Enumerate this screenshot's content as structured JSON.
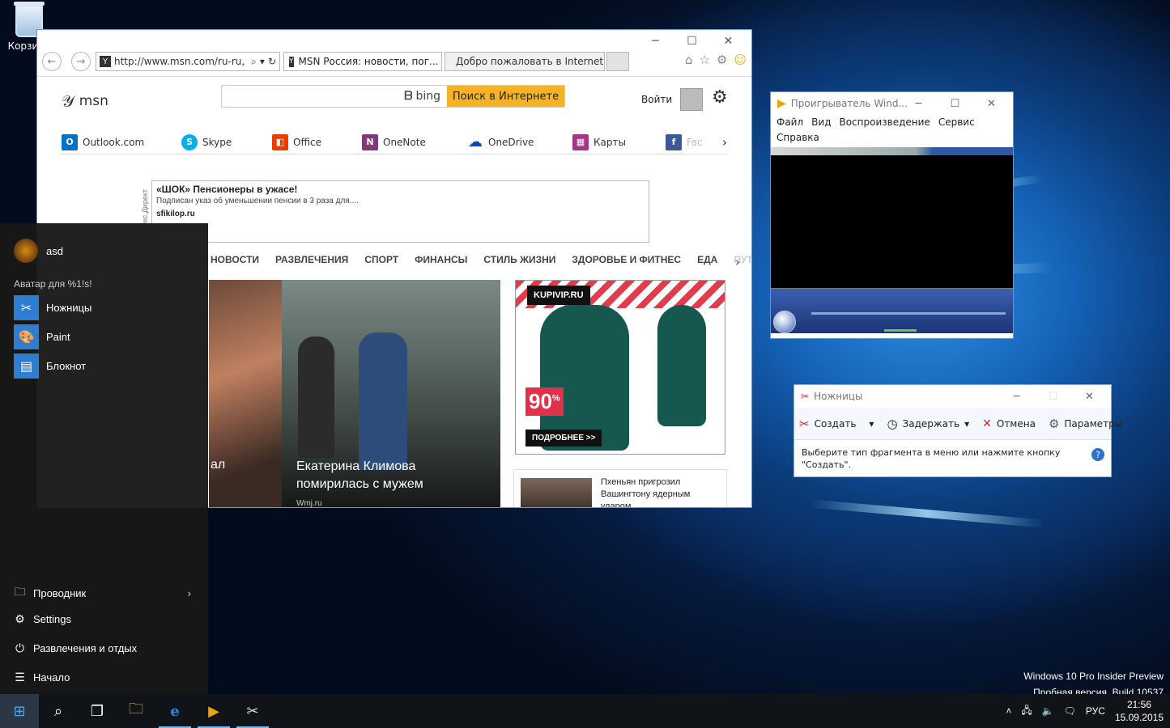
{
  "desktop": {
    "recycle_label": "Корзина",
    "watermark_line1": "Windows 10 Pro Insider Preview",
    "watermark_line2": "Пробная версия. Build 10537"
  },
  "ie": {
    "address": "http://www.msn.com/ru-ru,",
    "tab1": "MSN Россия: новости, пог...",
    "tab2": "Добро пожаловать в Internet ...",
    "msn": {
      "logo": "msn",
      "search_brand": "bing",
      "search_button": "Поиск в Интернете",
      "signin": "Войти"
    },
    "apps": [
      "Outlook.com",
      "Skype",
      "Office",
      "OneNote",
      "OneDrive",
      "Карты",
      "Fac"
    ],
    "ad": {
      "title": "«ШОК» Пенсионеры в ужасе!",
      "desc": "Подписан указ об уменьшении пенсии в 3 раза для....",
      "site": "sfikilop.ru",
      "side": "екс.Директ"
    },
    "categories": [
      "НОВОСТИ",
      "РАЗВЛЕЧЕНИЯ",
      "СПОРТ",
      "ФИНАНСЫ",
      "СТИЛЬ ЖИЗНИ",
      "ЗДОРОВЬЕ И ФИТНЕС",
      "ЕДА",
      "ПУТЕ"
    ],
    "hero1_caption": "ал",
    "hero2_caption_line1": "Екатерина Климова",
    "hero2_caption_line2": "помирилась с мужем",
    "hero2_source": "Wmj.ru",
    "banner": {
      "brand": "KUPIVIP.RU",
      "percent": "90",
      "pct_sign": "%",
      "more": "ПОДРОБНЕЕ >>"
    },
    "news2": {
      "line1": "Пхеньян пригрозил",
      "line2": "Вашингтону ядерным",
      "line3": "ударом"
    }
  },
  "start": {
    "user": "asd",
    "header": "Аватар для %1!s!",
    "apps": [
      "Ножницы",
      "Paint",
      "Блокнот"
    ],
    "places": [
      "Проводник",
      "Settings",
      "Развлечения и отдых",
      "Начало"
    ]
  },
  "wmp": {
    "title": "Проигрыватель Wind...",
    "menu": [
      "Файл",
      "Вид",
      "Воспроизведение",
      "Сервис",
      "Справка"
    ]
  },
  "snip": {
    "title": "Ножницы",
    "new": "Создать",
    "delay": "Задержать",
    "cancel": "Отмена",
    "options": "Параметры",
    "msg_line1": "Выберите тип фрагмента в меню или нажмите кнопку",
    "msg_line2": "\"Создать\"."
  },
  "tray": {
    "lang": "РУС",
    "time": "21:56",
    "date": "15.09.2015"
  }
}
